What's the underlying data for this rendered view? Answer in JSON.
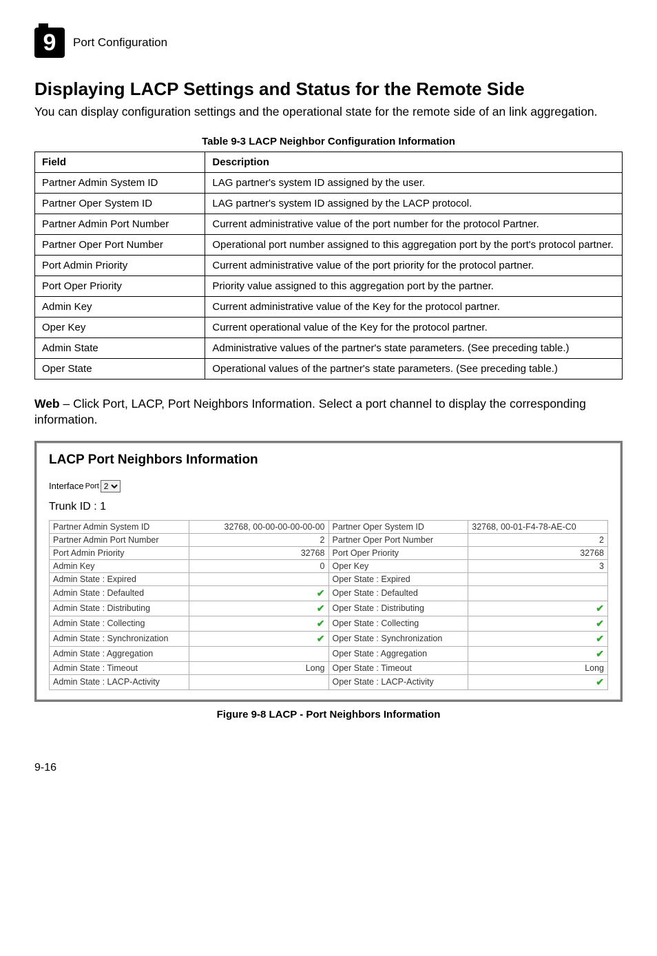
{
  "chapter": {
    "num": "9",
    "name": "Port Configuration"
  },
  "h1": "Displaying LACP Settings and Status for the Remote Side",
  "intro": "You can display configuration settings and the operational state for the remote side of an link aggregation.",
  "table93": {
    "caption": "Table 9-3  LACP Neighbor Configuration Information",
    "head": {
      "field": "Field",
      "desc": "Description"
    },
    "rows": [
      {
        "f": "Partner Admin System ID",
        "d": "LAG partner's system ID assigned by the user."
      },
      {
        "f": "Partner Oper System ID",
        "d": "LAG partner's system ID assigned by the LACP protocol."
      },
      {
        "f": "Partner Admin Port Number",
        "d": "Current administrative value of the port number for the protocol Partner."
      },
      {
        "f": "Partner Oper Port Number",
        "d": "Operational port number assigned to this aggregation port by the port's protocol partner."
      },
      {
        "f": "Port Admin Priority",
        "d": "Current administrative value of the port priority for the protocol partner."
      },
      {
        "f": "Port Oper Priority",
        "d": "Priority value assigned to this aggregation port by the partner."
      },
      {
        "f": "Admin Key",
        "d": "Current administrative value of the Key for the protocol partner."
      },
      {
        "f": "Oper Key",
        "d": "Current operational value of the Key for the protocol partner."
      },
      {
        "f": "Admin State",
        "d": "Administrative values of the partner's state parameters. (See preceding table.)"
      },
      {
        "f": "Oper State",
        "d": "Operational values of the partner's state parameters. (See preceding table.)"
      }
    ]
  },
  "web": {
    "bold": "Web",
    "rest": " – Click Port, LACP, Port Neighbors Information. Select a port channel to display the corresponding information."
  },
  "lacp": {
    "title": "LACP Port Neighbors Information",
    "iface_label": "Interface",
    "iface_sublabel": "Port",
    "iface_value": "2",
    "trunk": "Trunk ID : 1",
    "rows": [
      {
        "l": "Partner Admin System ID",
        "lv": "32768, 00-00-00-00-00-00",
        "r": "Partner Oper System ID",
        "rv": "32768, 00-01-F4-78-AE-C0",
        "lchk": false,
        "rchk": false,
        "rr": false
      },
      {
        "l": "Partner Admin Port Number",
        "lv": "2",
        "r": "Partner Oper Port Number",
        "rv": "2",
        "lchk": false,
        "rchk": false,
        "rr": true
      },
      {
        "l": "Port Admin Priority",
        "lv": "32768",
        "r": "Port Oper Priority",
        "rv": "32768",
        "lchk": false,
        "rchk": false,
        "rr": true
      },
      {
        "l": "Admin Key",
        "lv": "0",
        "r": "Oper Key",
        "rv": "3",
        "lchk": false,
        "rchk": false,
        "rr": true
      },
      {
        "l": "Admin State : Expired",
        "lv": "",
        "r": "Oper State : Expired",
        "rv": "",
        "lchk": false,
        "rchk": false,
        "rr": true
      },
      {
        "l": "Admin State : Defaulted",
        "lv": "",
        "r": "Oper State : Defaulted",
        "rv": "",
        "lchk": true,
        "rchk": false,
        "rr": true
      },
      {
        "l": "Admin State : Distributing",
        "lv": "",
        "r": "Oper State : Distributing",
        "rv": "",
        "lchk": true,
        "rchk": true,
        "rr": true
      },
      {
        "l": "Admin State : Collecting",
        "lv": "",
        "r": "Oper State : Collecting",
        "rv": "",
        "lchk": true,
        "rchk": true,
        "rr": true
      },
      {
        "l": "Admin State : Synchronization",
        "lv": "",
        "r": "Oper State : Synchronization",
        "rv": "",
        "lchk": true,
        "rchk": true,
        "rr": true
      },
      {
        "l": "Admin State : Aggregation",
        "lv": "",
        "r": "Oper State : Aggregation",
        "rv": "",
        "lchk": false,
        "rchk": true,
        "rr": true
      },
      {
        "l": "Admin State : Timeout",
        "lv": "Long",
        "r": "Oper State : Timeout",
        "rv": "Long",
        "lchk": false,
        "rchk": false,
        "rr": true
      },
      {
        "l": "Admin State : LACP-Activity",
        "lv": "",
        "r": "Oper State : LACP-Activity",
        "rv": "",
        "lchk": false,
        "rchk": true,
        "rr": true
      }
    ]
  },
  "fig_caption": "Figure 9-8   LACP - Port Neighbors Information",
  "pagenum": "9-16"
}
